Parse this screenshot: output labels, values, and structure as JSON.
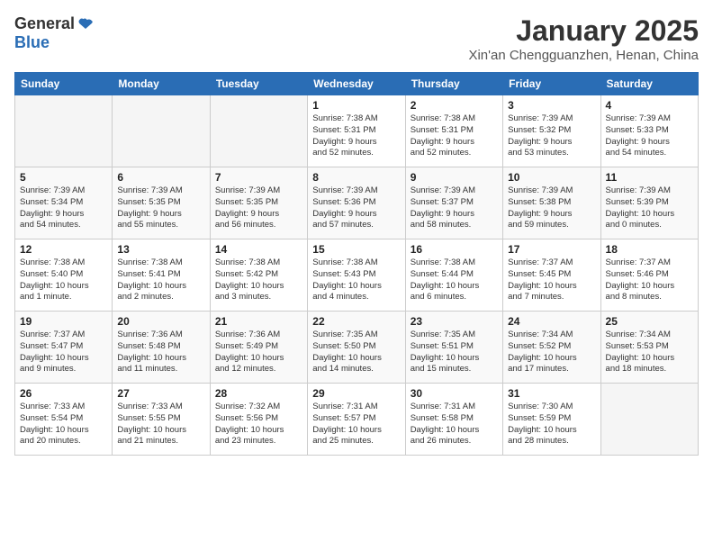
{
  "logo": {
    "general": "General",
    "blue": "Blue"
  },
  "title": "January 2025",
  "subtitle": "Xin'an Chengguanzhen, Henan, China",
  "headers": [
    "Sunday",
    "Monday",
    "Tuesday",
    "Wednesday",
    "Thursday",
    "Friday",
    "Saturday"
  ],
  "weeks": [
    [
      {
        "day": "",
        "info": "",
        "empty": true
      },
      {
        "day": "",
        "info": "",
        "empty": true
      },
      {
        "day": "",
        "info": "",
        "empty": true
      },
      {
        "day": "1",
        "info": "Sunrise: 7:38 AM\nSunset: 5:31 PM\nDaylight: 9 hours\nand 52 minutes.",
        "empty": false
      },
      {
        "day": "2",
        "info": "Sunrise: 7:38 AM\nSunset: 5:31 PM\nDaylight: 9 hours\nand 52 minutes.",
        "empty": false
      },
      {
        "day": "3",
        "info": "Sunrise: 7:39 AM\nSunset: 5:32 PM\nDaylight: 9 hours\nand 53 minutes.",
        "empty": false
      },
      {
        "day": "4",
        "info": "Sunrise: 7:39 AM\nSunset: 5:33 PM\nDaylight: 9 hours\nand 54 minutes.",
        "empty": false
      }
    ],
    [
      {
        "day": "5",
        "info": "Sunrise: 7:39 AM\nSunset: 5:34 PM\nDaylight: 9 hours\nand 54 minutes.",
        "empty": false
      },
      {
        "day": "6",
        "info": "Sunrise: 7:39 AM\nSunset: 5:35 PM\nDaylight: 9 hours\nand 55 minutes.",
        "empty": false
      },
      {
        "day": "7",
        "info": "Sunrise: 7:39 AM\nSunset: 5:35 PM\nDaylight: 9 hours\nand 56 minutes.",
        "empty": false
      },
      {
        "day": "8",
        "info": "Sunrise: 7:39 AM\nSunset: 5:36 PM\nDaylight: 9 hours\nand 57 minutes.",
        "empty": false
      },
      {
        "day": "9",
        "info": "Sunrise: 7:39 AM\nSunset: 5:37 PM\nDaylight: 9 hours\nand 58 minutes.",
        "empty": false
      },
      {
        "day": "10",
        "info": "Sunrise: 7:39 AM\nSunset: 5:38 PM\nDaylight: 9 hours\nand 59 minutes.",
        "empty": false
      },
      {
        "day": "11",
        "info": "Sunrise: 7:39 AM\nSunset: 5:39 PM\nDaylight: 10 hours\nand 0 minutes.",
        "empty": false
      }
    ],
    [
      {
        "day": "12",
        "info": "Sunrise: 7:38 AM\nSunset: 5:40 PM\nDaylight: 10 hours\nand 1 minute.",
        "empty": false
      },
      {
        "day": "13",
        "info": "Sunrise: 7:38 AM\nSunset: 5:41 PM\nDaylight: 10 hours\nand 2 minutes.",
        "empty": false
      },
      {
        "day": "14",
        "info": "Sunrise: 7:38 AM\nSunset: 5:42 PM\nDaylight: 10 hours\nand 3 minutes.",
        "empty": false
      },
      {
        "day": "15",
        "info": "Sunrise: 7:38 AM\nSunset: 5:43 PM\nDaylight: 10 hours\nand 4 minutes.",
        "empty": false
      },
      {
        "day": "16",
        "info": "Sunrise: 7:38 AM\nSunset: 5:44 PM\nDaylight: 10 hours\nand 6 minutes.",
        "empty": false
      },
      {
        "day": "17",
        "info": "Sunrise: 7:37 AM\nSunset: 5:45 PM\nDaylight: 10 hours\nand 7 minutes.",
        "empty": false
      },
      {
        "day": "18",
        "info": "Sunrise: 7:37 AM\nSunset: 5:46 PM\nDaylight: 10 hours\nand 8 minutes.",
        "empty": false
      }
    ],
    [
      {
        "day": "19",
        "info": "Sunrise: 7:37 AM\nSunset: 5:47 PM\nDaylight: 10 hours\nand 9 minutes.",
        "empty": false
      },
      {
        "day": "20",
        "info": "Sunrise: 7:36 AM\nSunset: 5:48 PM\nDaylight: 10 hours\nand 11 minutes.",
        "empty": false
      },
      {
        "day": "21",
        "info": "Sunrise: 7:36 AM\nSunset: 5:49 PM\nDaylight: 10 hours\nand 12 minutes.",
        "empty": false
      },
      {
        "day": "22",
        "info": "Sunrise: 7:35 AM\nSunset: 5:50 PM\nDaylight: 10 hours\nand 14 minutes.",
        "empty": false
      },
      {
        "day": "23",
        "info": "Sunrise: 7:35 AM\nSunset: 5:51 PM\nDaylight: 10 hours\nand 15 minutes.",
        "empty": false
      },
      {
        "day": "24",
        "info": "Sunrise: 7:34 AM\nSunset: 5:52 PM\nDaylight: 10 hours\nand 17 minutes.",
        "empty": false
      },
      {
        "day": "25",
        "info": "Sunrise: 7:34 AM\nSunset: 5:53 PM\nDaylight: 10 hours\nand 18 minutes.",
        "empty": false
      }
    ],
    [
      {
        "day": "26",
        "info": "Sunrise: 7:33 AM\nSunset: 5:54 PM\nDaylight: 10 hours\nand 20 minutes.",
        "empty": false
      },
      {
        "day": "27",
        "info": "Sunrise: 7:33 AM\nSunset: 5:55 PM\nDaylight: 10 hours\nand 21 minutes.",
        "empty": false
      },
      {
        "day": "28",
        "info": "Sunrise: 7:32 AM\nSunset: 5:56 PM\nDaylight: 10 hours\nand 23 minutes.",
        "empty": false
      },
      {
        "day": "29",
        "info": "Sunrise: 7:31 AM\nSunset: 5:57 PM\nDaylight: 10 hours\nand 25 minutes.",
        "empty": false
      },
      {
        "day": "30",
        "info": "Sunrise: 7:31 AM\nSunset: 5:58 PM\nDaylight: 10 hours\nand 26 minutes.",
        "empty": false
      },
      {
        "day": "31",
        "info": "Sunrise: 7:30 AM\nSunset: 5:59 PM\nDaylight: 10 hours\nand 28 minutes.",
        "empty": false
      },
      {
        "day": "",
        "info": "",
        "empty": true
      }
    ]
  ]
}
